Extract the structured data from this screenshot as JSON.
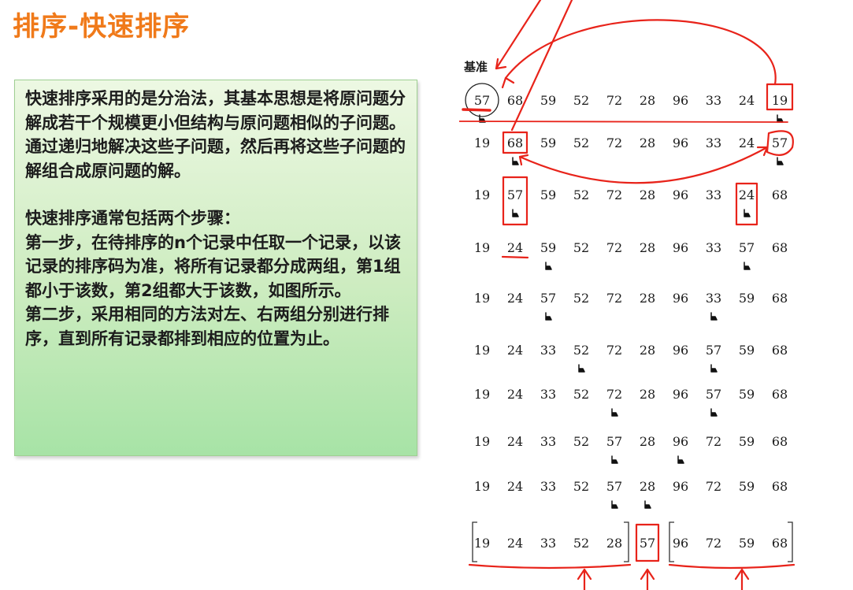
{
  "title": "排序-快速排序",
  "description": {
    "paragraph1": "快速排序采用的是分治法，其基本思想是将原问题分解成若干个规模更小但结构与原问题相似的子问题。通过递归地解决这些子问题，然后再将这些子问题的解组合成原问题的解。",
    "paragraph2_intro": "快速排序通常包括两个步骤：",
    "step1": "第一步，在待排序的n个记录中任取一个记录，以该记录的排序码为准，将所有记录都分成两组，第1组都小于该数，第2组都大于该数，如图所示。",
    "step2": "第二步，采用相同的方法对左、右两组分别进行排序，直到所有记录都排到相应的位置为止。"
  },
  "diagram": {
    "pivot_label": "基准",
    "rows": [
      [
        "57",
        "68",
        "59",
        "52",
        "72",
        "28",
        "96",
        "33",
        "24",
        "19"
      ],
      [
        "19",
        "68",
        "59",
        "52",
        "72",
        "28",
        "96",
        "33",
        "24",
        "57"
      ],
      [
        "19",
        "57",
        "59",
        "52",
        "72",
        "28",
        "96",
        "33",
        "24",
        "68"
      ],
      [
        "19",
        "24",
        "59",
        "52",
        "72",
        "28",
        "96",
        "33",
        "57",
        "68"
      ],
      [
        "19",
        "24",
        "57",
        "52",
        "72",
        "28",
        "96",
        "33",
        "59",
        "68"
      ],
      [
        "19",
        "24",
        "33",
        "52",
        "72",
        "28",
        "96",
        "57",
        "59",
        "68"
      ],
      [
        "19",
        "24",
        "33",
        "52",
        "72",
        "28",
        "96",
        "57",
        "59",
        "68"
      ],
      [
        "19",
        "24",
        "33",
        "52",
        "57",
        "28",
        "96",
        "72",
        "59",
        "68"
      ],
      [
        "19",
        "24",
        "33",
        "52",
        "57",
        "28",
        "96",
        "72",
        "59",
        "68"
      ],
      [
        "19",
        "24",
        "33",
        "52",
        "28",
        "57",
        "96",
        "72",
        "59",
        "68"
      ]
    ],
    "pointers": [
      [
        0,
        9
      ],
      [
        1,
        9
      ],
      [
        1,
        8
      ],
      [
        2,
        8
      ],
      [
        2,
        7
      ],
      [
        3,
        7
      ],
      [
        4,
        7
      ],
      [
        4,
        6
      ],
      [
        4,
        5
      ],
      []
    ],
    "annotation_color": "#e8231a"
  }
}
